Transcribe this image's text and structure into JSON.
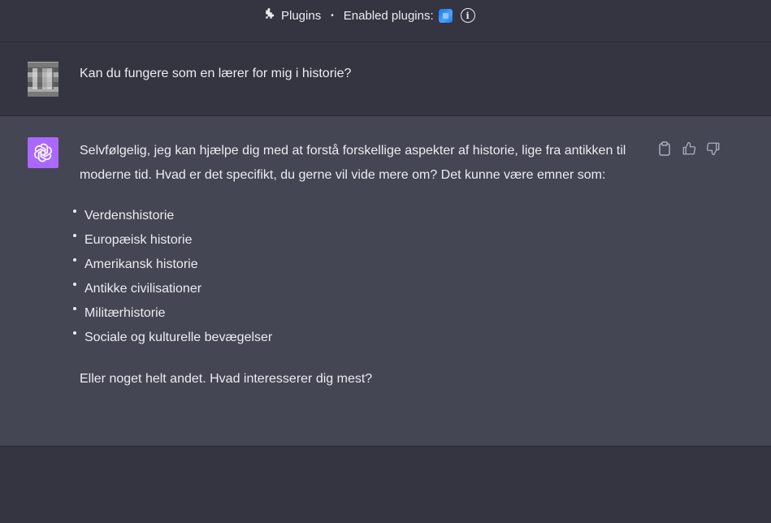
{
  "header": {
    "plugins_label": "Plugins",
    "separator": "•",
    "enabled_label": "Enabled plugins:",
    "info_symbol": "i"
  },
  "conversation": {
    "user_message": "Kan du fungere som en lærer for mig i historie?",
    "assistant": {
      "intro": "Selvfølgelig, jeg kan hjælpe dig med at forstå forskellige aspekter af historie, lige fra antikken til moderne tid. Hvad er det specifikt, du gerne vil vide mere om? Det kunne være emner som:",
      "topics": [
        "Verdenshistorie",
        "Europæisk historie",
        "Amerikansk historie",
        "Antikke civilisationer",
        "Militærhistorie",
        "Sociale og kulturelle bevægelser"
      ],
      "closing": "Eller noget helt andet. Hvad interesserer dig mest?"
    }
  },
  "icons": {
    "header": [
      "puzzle-icon",
      "plugin-badge-icon",
      "info-icon"
    ],
    "actions": [
      "copy-icon",
      "thumbs-up-icon",
      "thumbs-down-icon"
    ],
    "assistant_avatar": "openai-logo-icon"
  },
  "colors": {
    "background": "#343541",
    "assistant_background": "#444654",
    "assistant_avatar": "#ab68ff",
    "text": "#ececf1",
    "muted_icon": "#acacbe"
  }
}
